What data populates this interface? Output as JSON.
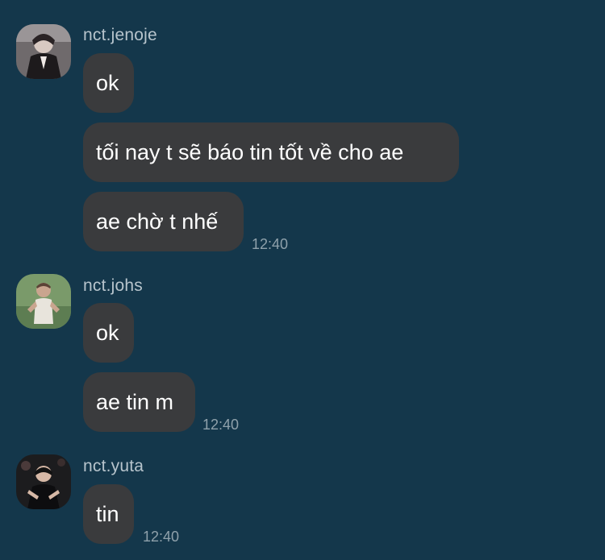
{
  "groups": [
    {
      "sender": "nct.jenoje",
      "avatar_icon": "user-avatar-icon",
      "messages": [
        "ok",
        "tối nay t sẽ báo tin tốt về cho ae",
        "ae chờ t nhế"
      ],
      "time": "12:40"
    },
    {
      "sender": "nct.johs",
      "avatar_icon": "user-avatar-icon",
      "messages": [
        "ok",
        "ae tin m"
      ],
      "time": "12:40"
    },
    {
      "sender": "nct.yuta",
      "avatar_icon": "user-avatar-icon",
      "messages": [
        "tin"
      ],
      "time": "12:40"
    }
  ],
  "colors": {
    "background": "#14374b",
    "bubble": "#3a3b3d",
    "sender_text": "#b7c4cc",
    "timestamp_text": "#8fa1ab"
  }
}
